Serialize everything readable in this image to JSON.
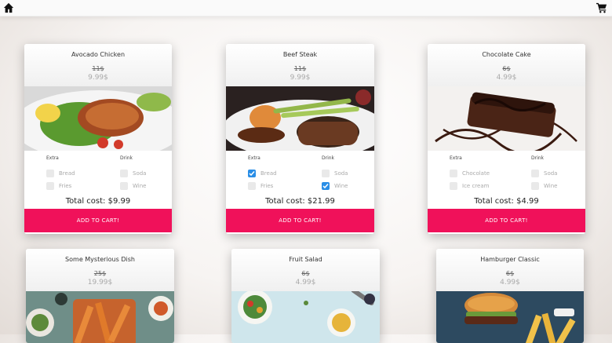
{
  "nav": {
    "home_icon": "home-icon",
    "cart_icon": "cart-icon"
  },
  "cards": [
    {
      "title": "Avocado Chicken",
      "old_price": "11$",
      "price": "9.99$",
      "options": {
        "extra_label": "Extra",
        "drink_label": "Drink",
        "extras": [
          {
            "label": "Bread",
            "checked": false
          },
          {
            "label": "Fries",
            "checked": false
          }
        ],
        "drinks": [
          {
            "label": "Soda",
            "checked": false
          },
          {
            "label": "Wine",
            "checked": false
          }
        ]
      },
      "total": "Total cost: $9.99",
      "button": "ADD TO CART!"
    },
    {
      "title": "Beef Steak",
      "old_price": "11$",
      "price": "9.99$",
      "options": {
        "extra_label": "Extra",
        "drink_label": "Drink",
        "extras": [
          {
            "label": "Bread",
            "checked": true
          },
          {
            "label": "Fries",
            "checked": false
          }
        ],
        "drinks": [
          {
            "label": "Soda",
            "checked": false
          },
          {
            "label": "Wine",
            "checked": true
          }
        ]
      },
      "total": "Total cost: $21.99",
      "button": "ADD TO CART!"
    },
    {
      "title": "Chocolate Cake",
      "old_price": "6$",
      "price": "4.99$",
      "options": {
        "extra_label": "Extra",
        "drink_label": "Drink",
        "extras": [
          {
            "label": "Chocolate",
            "checked": false
          },
          {
            "label": "Ice cream",
            "checked": false
          }
        ],
        "drinks": [
          {
            "label": "Soda",
            "checked": false
          },
          {
            "label": "Wine",
            "checked": false
          }
        ]
      },
      "total": "Total cost: $4.99",
      "button": "ADD TO CART!"
    },
    {
      "title": "Some Mysterious Dish",
      "old_price": "25$",
      "price": "19.99$"
    },
    {
      "title": "Fruit Salad",
      "old_price": "6$",
      "price": "4.99$"
    },
    {
      "title": "Hamburger Classic",
      "old_price": "6$",
      "price": "4.99$"
    }
  ],
  "colors": {
    "accent": "#f0115a",
    "checkbox_on": "#2a8ee6"
  }
}
